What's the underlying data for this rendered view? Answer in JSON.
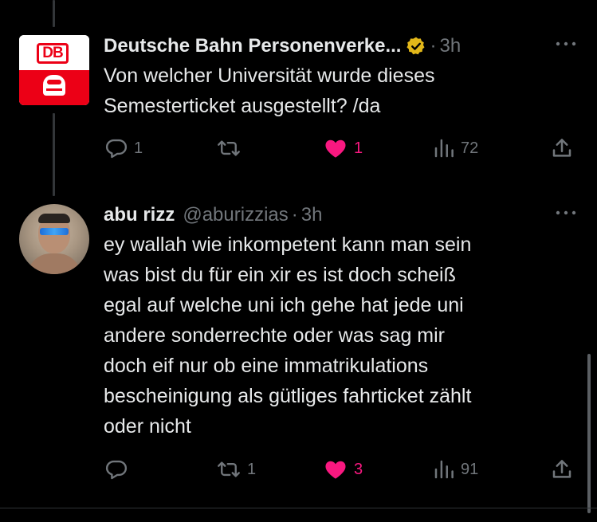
{
  "tweets": [
    {
      "author": {
        "name": "Deutsche Bahn Personenverke...",
        "verified": true,
        "avatar_text": "DB"
      },
      "time": "3h",
      "text_lines": [
        "Von welcher Universität wurde dieses",
        "Semesterticket ausgestellt? /da"
      ],
      "stats": {
        "replies": "1",
        "retweets": "",
        "likes": "1",
        "views": "72"
      },
      "liked": true
    },
    {
      "author": {
        "name": "abu rizz",
        "handle": "@aburizzias"
      },
      "time": "3h",
      "text_lines": [
        "ey wallah wie inkompetent kann man sein",
        "was bist du für ein xir es ist doch scheiß",
        "egal auf welche uni ich gehe hat jede uni",
        "andere sonderrechte oder was sag mir",
        "doch eif nur ob eine immatrikulations",
        "bescheinigung als gütliges fahrticket zählt",
        "oder nicht"
      ],
      "stats": {
        "replies": "",
        "retweets": "1",
        "likes": "3",
        "views": "91"
      },
      "liked": true
    }
  ],
  "ui": {
    "separator": "·",
    "colors": {
      "background": "#000000",
      "text": "#e7e9ea",
      "muted": "#71767b",
      "like": "#f91880",
      "verified_gold": "#e2b719",
      "db_red": "#ec0016"
    }
  }
}
